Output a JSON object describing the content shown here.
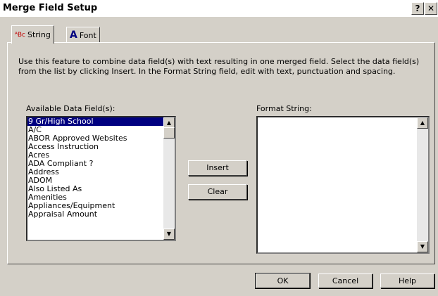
{
  "window": {
    "title": "Merge Field Setup",
    "help_glyph": "?",
    "close_glyph": "✕"
  },
  "tabs": [
    {
      "label": "String",
      "icon_glyph": "ᴬBc",
      "icon": "abc-text-icon",
      "selected": true
    },
    {
      "label": "Font",
      "icon_glyph": "A",
      "icon": "font-a-icon",
      "selected": false
    }
  ],
  "description": "Use this feature to combine data field(s) with text resulting in one merged field.  Select the data field(s) from the list by clicking Insert.  In the Format String field, edit with text, punctuation and spacing.",
  "available": {
    "label": "Available Data Field(s):",
    "items": [
      "9 Gr/High School",
      "A/C",
      "ABOR Approved Websites",
      "Access Instruction",
      "Acres",
      "ADA Compliant ?",
      "Address",
      "ADOM",
      "Also Listed As",
      "Amenities",
      "Appliances/Equipment",
      "Appraisal Amount"
    ],
    "selected_item": "9 Gr/High School"
  },
  "format": {
    "label": "Format String:",
    "value": ""
  },
  "buttons": {
    "insert": "Insert",
    "clear": "Clear",
    "ok": "OK",
    "cancel": "Cancel",
    "help": "Help"
  },
  "colors": {
    "selection": "#000080",
    "tab_icon_a": "#000080",
    "tab_icon_abc": "#c00000"
  }
}
